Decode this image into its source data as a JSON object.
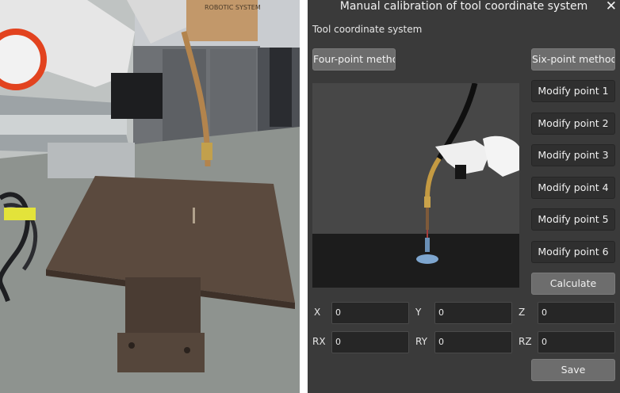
{
  "dialog": {
    "title": "Manual calibration of tool coordinate system",
    "section_label": "Tool coordinate system",
    "four_point_label": "Four-point method",
    "six_point_label": "Six-point method",
    "modify_points": [
      "Modify point 1",
      "Modify point 2",
      "Modify point 3",
      "Modify point 4",
      "Modify point 5",
      "Modify point 6"
    ],
    "calculate_label": "Calculate",
    "save_label": "Save",
    "fields": [
      {
        "label": "X",
        "value": "0"
      },
      {
        "label": "Y",
        "value": "0"
      },
      {
        "label": "Z",
        "value": "0"
      },
      {
        "label": "RX",
        "value": "0"
      },
      {
        "label": "RY",
        "value": "0"
      },
      {
        "label": "RZ",
        "value": "0"
      }
    ]
  },
  "photo": {
    "box_label": "ROBOTIC SYSTEM"
  }
}
